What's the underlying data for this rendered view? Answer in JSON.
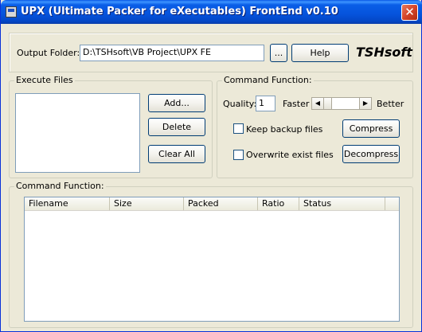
{
  "window": {
    "title": "UPX (Ultimate Packer for eXecutables) FrontEnd v0.10",
    "close_glyph": "✕"
  },
  "output": {
    "label": "Output Folder:",
    "value": "D:\\TSHsoft\\VB Project\\UPX FE",
    "browse_label": "...",
    "help_label": "Help",
    "brand": "TSHsoft"
  },
  "execute_files": {
    "title": "Execute Files",
    "add_label": "Add...",
    "delete_label": "Delete",
    "clear_label": "Clear All"
  },
  "command_function": {
    "title": "Command Function:",
    "quality_label": "Quality:",
    "quality_value": "1",
    "faster_label": "Faster",
    "better_label": "Better",
    "slider_level": 0,
    "keep_backup_label": "Keep backup files",
    "keep_backup_checked": false,
    "overwrite_label": "Overwrite exist files",
    "overwrite_checked": false,
    "compress_label": "Compress",
    "decompress_label": "Decompress"
  },
  "results": {
    "title": "Command Function:",
    "columns": [
      "Filename",
      "Size",
      "Packed",
      "Ratio",
      "Status"
    ]
  },
  "icons": {
    "left_arrow": "◀",
    "right_arrow": "▶"
  }
}
